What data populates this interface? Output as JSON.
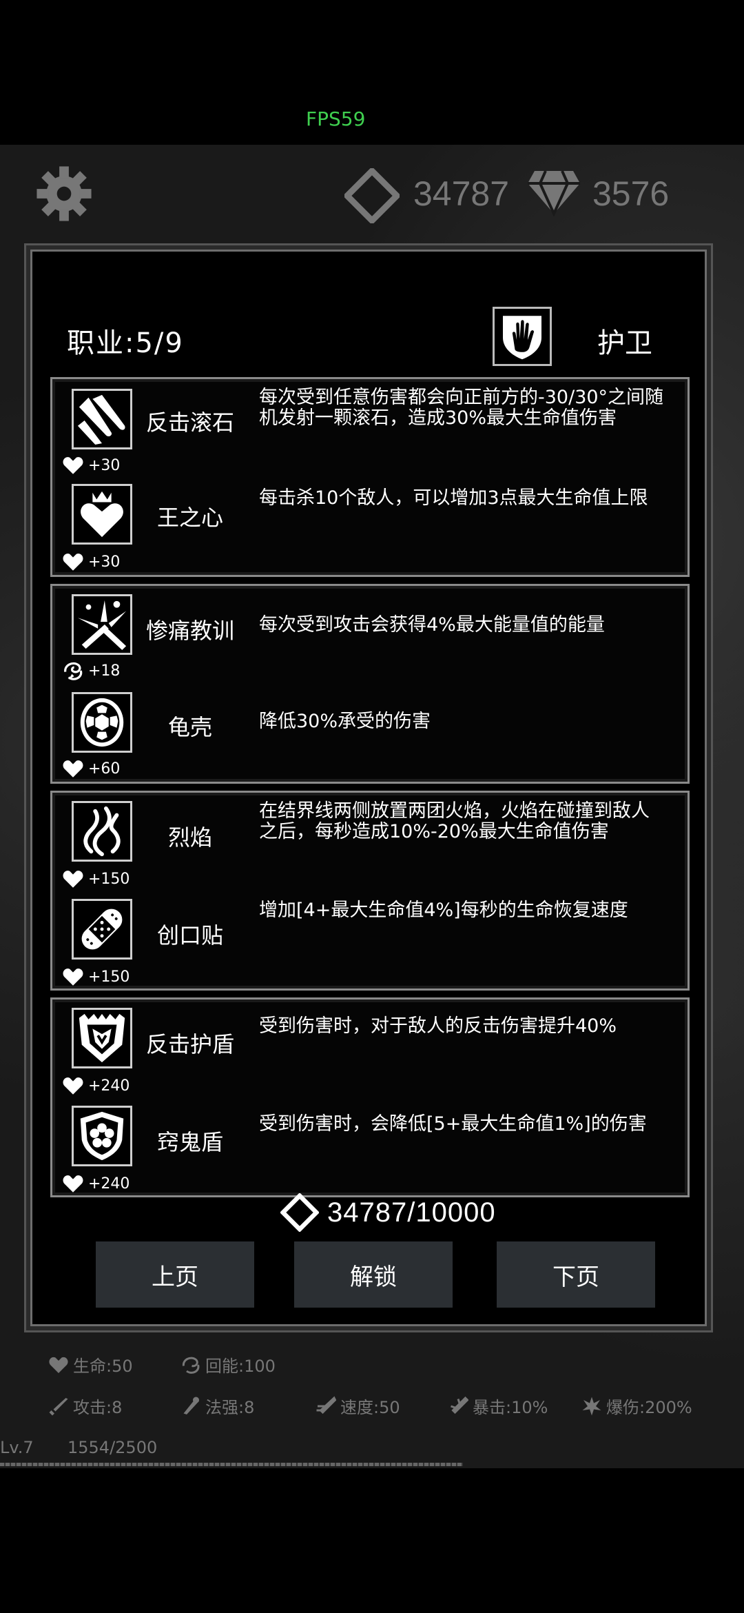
{
  "hud": {
    "fps": "FPS59",
    "gems": "34787",
    "diamonds": "3576"
  },
  "panel": {
    "profession_label": "职业:5/9",
    "profession_name": "护卫",
    "groups": [
      {
        "skills": [
          {
            "name": "反击滚石",
            "desc": "每次受到任意伤害都会向正前方的-30/30°之间随机发射一颗滚石，造成30%最大生命值伤害",
            "bonus": "+30",
            "bonus_icon": "heart-icon",
            "icon": "rock-streak-icon"
          },
          {
            "name": "王之心",
            "desc": "每击杀10个敌人，可以增加3点最大生命值上限",
            "bonus": "+30",
            "bonus_icon": "heart-icon",
            "icon": "crowned-heart-icon"
          }
        ]
      },
      {
        "skills": [
          {
            "name": "惨痛教训",
            "desc": "每次受到攻击会获得4%最大能量值的能量",
            "bonus": "+18",
            "bonus_icon": "energy-swirl-icon",
            "icon": "shatter-bone-icon"
          },
          {
            "name": "龟壳",
            "desc": "降低30%承受的伤害",
            "bonus": "+60",
            "bonus_icon": "heart-icon",
            "icon": "turtle-shell-icon"
          }
        ]
      },
      {
        "skills": [
          {
            "name": "烈焰",
            "desc": "在结界线两侧放置两团火焰，火焰在碰撞到敌人之后，每秒造成10%-20%最大生命值伤害",
            "bonus": "+150",
            "bonus_icon": "heart-icon",
            "icon": "flame-icon"
          },
          {
            "name": "创口贴",
            "desc": "增加[4+最大生命值4%]每秒的生命恢复速度",
            "bonus": "+150",
            "bonus_icon": "heart-icon",
            "icon": "bandage-icon"
          }
        ]
      },
      {
        "skills": [
          {
            "name": "反击护盾",
            "desc": "受到伤害时，对于敌人的反击伤害提升40%",
            "bonus": "+240",
            "bonus_icon": "heart-icon",
            "icon": "spiked-shield-icon"
          },
          {
            "name": "窍鬼盾",
            "desc": "受到伤害时，会降低[5+最大生命值1%]的伤害",
            "bonus": "+240",
            "bonus_icon": "heart-icon",
            "icon": "flower-shield-icon"
          }
        ]
      }
    ],
    "cost": "34787/10000",
    "buttons": {
      "prev": "上页",
      "unlock": "解锁",
      "next": "下页"
    }
  },
  "stats": {
    "hp": "生命:50",
    "energy": "回能:100",
    "attack": "攻击:8",
    "magic": "法强:8",
    "speed": "速度:50",
    "crit": "暴击:10%",
    "crit_dmg": "爆伤:200%",
    "level": "Lv.7",
    "exp": "1554/2500"
  },
  "colors": {
    "fps": "#3fcf4f",
    "panel_border": "#6d6d6d",
    "button_bg": "#2b2f33"
  }
}
